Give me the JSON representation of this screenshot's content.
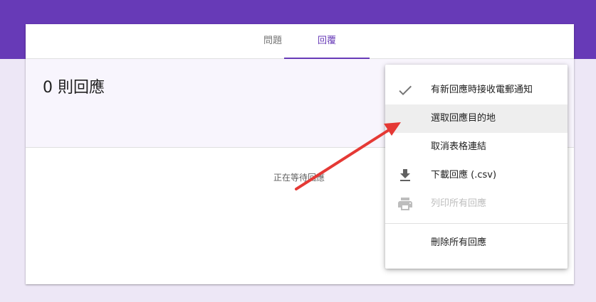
{
  "colors": {
    "primary": "#673ab7",
    "background": "#ede7f6",
    "annotation_arrow": "#e53935"
  },
  "tabs": [
    {
      "label": "問題",
      "active": false
    },
    {
      "label": "回覆",
      "active": true
    }
  ],
  "summary": {
    "count_label": "0 則回應"
  },
  "empty_state": {
    "text": "正在等待回應"
  },
  "menu": {
    "items": [
      {
        "label": "有新回應時接收電郵通知",
        "icon": "check-icon",
        "checked": true,
        "disabled": false
      },
      {
        "label": "選取回應目的地",
        "icon": "",
        "checked": false,
        "disabled": false,
        "hovered": true
      },
      {
        "label": "取消表格連結",
        "icon": "",
        "checked": false,
        "disabled": false
      },
      {
        "label": "下載回應 (.csv)",
        "icon": "download-icon",
        "checked": false,
        "disabled": false
      },
      {
        "label": "列印所有回應",
        "icon": "print-icon",
        "checked": false,
        "disabled": true
      },
      {
        "label": "刪除所有回應",
        "icon": "",
        "checked": false,
        "disabled": false
      }
    ]
  }
}
